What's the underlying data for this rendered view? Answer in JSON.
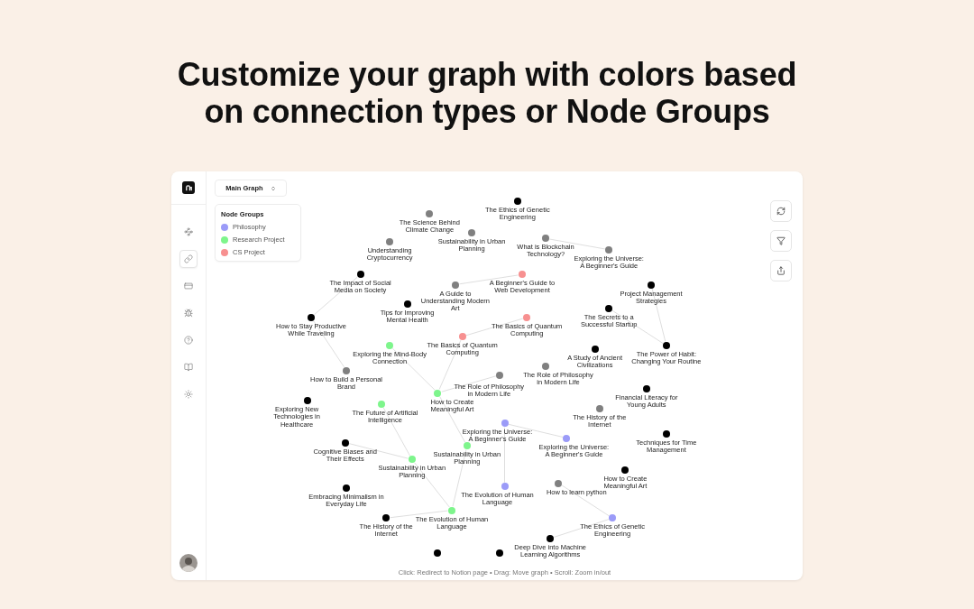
{
  "heading": "Customize your graph with colors based on connection types or Node Groups",
  "sidebar": {
    "items": [
      {
        "selected": false
      },
      {
        "selected": true
      },
      {
        "selected": false
      },
      {
        "selected": false
      },
      {
        "selected": false
      },
      {
        "selected": false
      },
      {
        "selected": false
      }
    ]
  },
  "graph_selector": {
    "value": "Main Graph"
  },
  "legend": {
    "title": "Node Groups",
    "items": [
      {
        "label": "Philosophy",
        "color": "#9b9bf8"
      },
      {
        "label": "Research Project",
        "color": "#7ef58c"
      },
      {
        "label": "CS Project",
        "color": "#f79090"
      }
    ]
  },
  "graph": {
    "nodes": [
      {
        "label": "The Science Behind Climate Change",
        "color": "#808080"
      },
      {
        "label": "The Ethics of Genetic Engineering",
        "color": "#000000"
      },
      {
        "label": "Sustainability in Urban Planning",
        "color": "#808080"
      },
      {
        "label": "What is Blockchain Technology?",
        "color": "#808080"
      },
      {
        "label": "Exploring the Universe: A Beginner's Guide",
        "color": "#808080"
      },
      {
        "label": "Understanding Cryptocurrency",
        "color": "#808080"
      },
      {
        "label": "The Impact of Social Media on Society",
        "color": "#000000"
      },
      {
        "label": "A Guide to Understanding Modern Art",
        "color": "#808080"
      },
      {
        "label": "A Beginner's Guide to Web Development",
        "color": "#f79090"
      },
      {
        "label": "Project Management Strategies",
        "color": "#000000"
      },
      {
        "label": "Tips for Improving Mental Health",
        "color": "#000000"
      },
      {
        "label": "How to Stay Productive While Traveling",
        "color": "#000000"
      },
      {
        "label": "The Secrets to a Successful Startup",
        "color": "#000000"
      },
      {
        "label": "The Basics of Quantum Computing",
        "color": "#f79090"
      },
      {
        "label": "The Basics of Quantum Computing",
        "color": "#f79090"
      },
      {
        "label": "Exploring the Mind-Body Connection",
        "color": "#7ef58c"
      },
      {
        "label": "A Study of Ancient Civilizations",
        "color": "#000000"
      },
      {
        "label": "The Power of Habit: Changing Your Routine",
        "color": "#000000"
      },
      {
        "label": "How to Build a Personal Brand",
        "color": "#808080"
      },
      {
        "label": "The Role of Philosophy in Modern Life",
        "color": "#808080"
      },
      {
        "label": "The Role of Philosophy in Modern Life",
        "color": "#808080"
      },
      {
        "label": "How to Create Meaningful Art",
        "color": "#7ef58c"
      },
      {
        "label": "Exploring New Technologies in Healthcare",
        "color": "#000000"
      },
      {
        "label": "The Future of Artificial Intelligence",
        "color": "#7ef58c"
      },
      {
        "label": "Financial Literacy for Young Adults",
        "color": "#000000"
      },
      {
        "label": "The History of the Internet",
        "color": "#808080"
      },
      {
        "label": "Exploring the Universe: A Beginner's Guide",
        "color": "#9b9bf8"
      },
      {
        "label": "Exploring the Universe: A Beginner's Guide",
        "color": "#9b9bf8"
      },
      {
        "label": "Techniques for Time Management",
        "color": "#000000"
      },
      {
        "label": "Cognitive Biases and Their Effects",
        "color": "#000000"
      },
      {
        "label": "Sustainability in Urban Planning",
        "color": "#7ef58c"
      },
      {
        "label": "Sustainability in Urban Planning",
        "color": "#7ef58c"
      },
      {
        "label": "How to Create Meaningful Art",
        "color": "#000000"
      },
      {
        "label": "Embracing Minimalism in Everyday Life",
        "color": "#000000"
      },
      {
        "label": "How to learn python",
        "color": "#808080"
      },
      {
        "label": "The Evolution of Human Language",
        "color": "#9b9bf8"
      },
      {
        "label": "The Evolution of Human Language",
        "color": "#7ef58c"
      },
      {
        "label": "The History of the Internet",
        "color": "#000000"
      },
      {
        "label": "The Ethics of Genetic Engineering",
        "color": "#9b9bf8"
      },
      {
        "label": "Deep Dive into Machine Learning Algorithms",
        "color": "#000000"
      },
      {
        "color": "#000000"
      },
      {
        "color": "#000000"
      }
    ]
  },
  "hint": "Click: Redirect to Notion page • Drag: Move graph • Scroll: Zoom in/out"
}
